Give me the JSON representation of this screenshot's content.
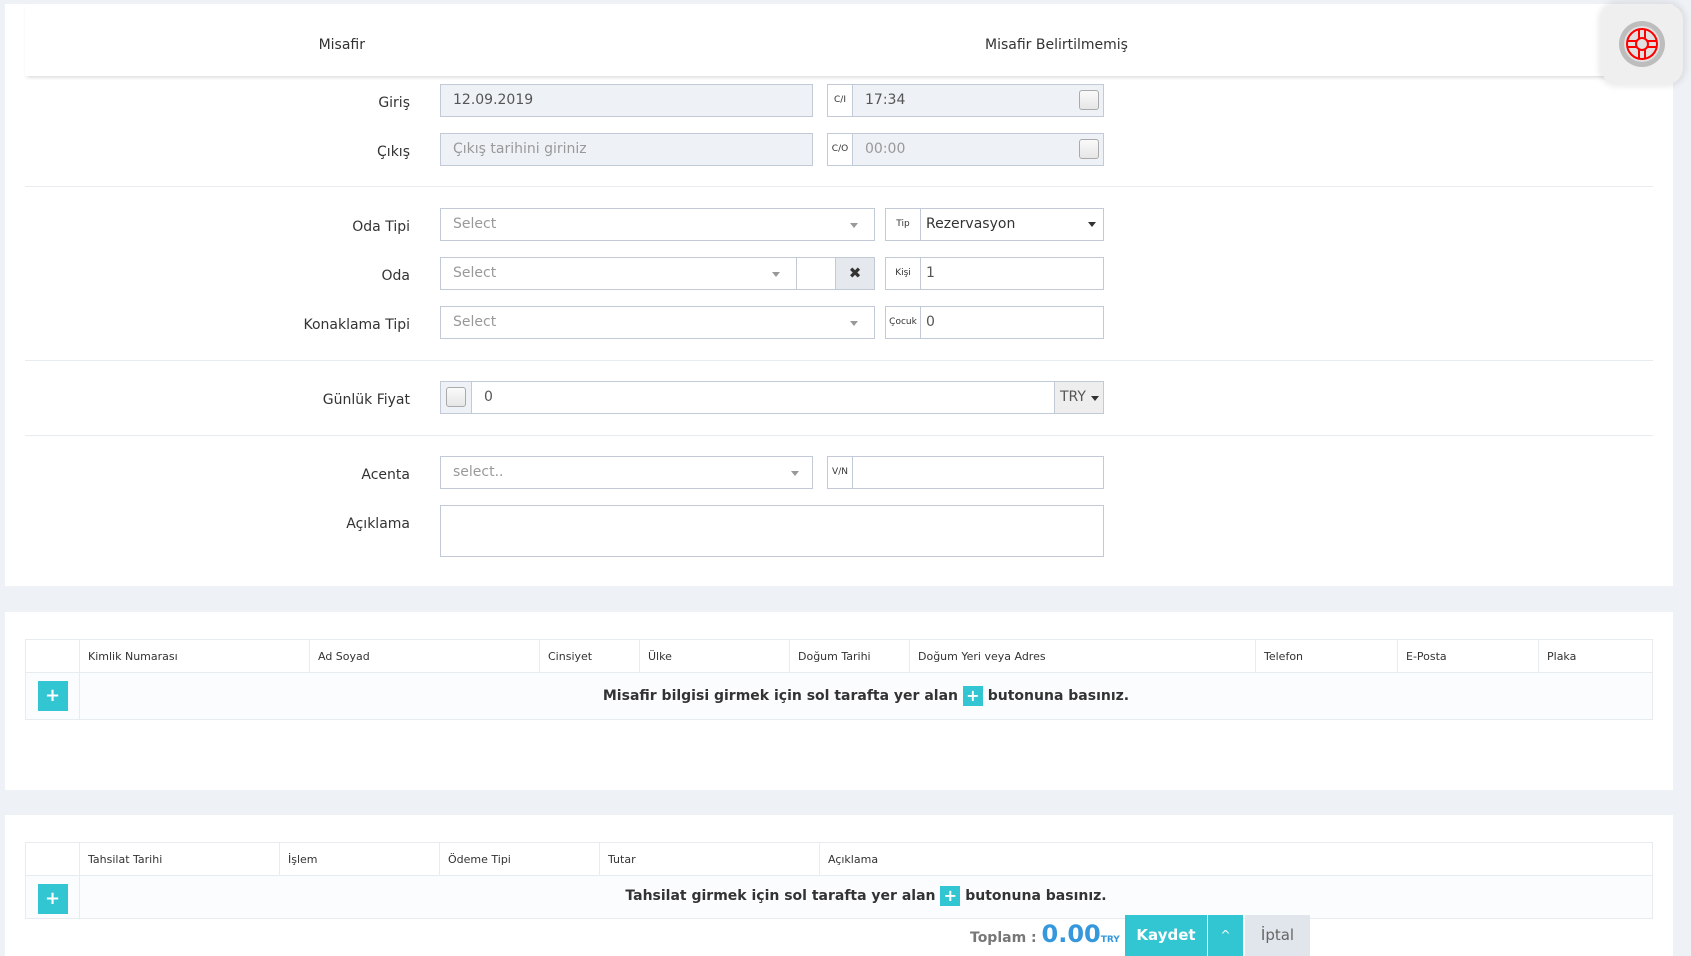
{
  "header": {
    "guest_label": "Misafir",
    "guest_value": "Misafir Belirtilmemiş"
  },
  "help_icon": "lifebuoy-icon",
  "form": {
    "checkin": {
      "label": "Giriş",
      "date": "12.09.2019",
      "time_addon": "C/I",
      "time": "17:34"
    },
    "checkout": {
      "label": "Çıkış",
      "date_placeholder": "Çıkış tarihini giriniz",
      "time_addon": "C/O",
      "time_placeholder": "00:00"
    },
    "room_type": {
      "label": "Oda Tipi",
      "placeholder": "Select"
    },
    "type": {
      "addon": "Tip",
      "value": "Rezervasyon"
    },
    "room": {
      "label": "Oda",
      "placeholder": "Select",
      "clear_icon": "close-icon"
    },
    "persons": {
      "addon": "Kişi",
      "value": "1"
    },
    "board_type": {
      "label": "Konaklama Tipi",
      "placeholder": "Select"
    },
    "children": {
      "addon": "Çocuk",
      "value": "0"
    },
    "daily_price": {
      "label": "Günlük Fiyat",
      "value": "0",
      "currency": "TRY"
    },
    "agency": {
      "label": "Acenta",
      "placeholder": "select..",
      "vn_addon": "V/N",
      "vn_value": ""
    },
    "note": {
      "label": "Açıklama",
      "value": ""
    }
  },
  "guests_table": {
    "columns": [
      "",
      "Kimlik Numarası",
      "Ad Soyad",
      "Cinsiyet",
      "Ülke",
      "Doğum Tarihi",
      "Doğum Yeri veya Adres",
      "Telefon",
      "E-Posta",
      "Plaka"
    ],
    "add_label": "+",
    "empty_msg_before": "Misafir bilgisi girmek için sol tarafta yer alan",
    "empty_msg_after": "butonuna basınız."
  },
  "payments_table": {
    "columns": [
      "",
      "Tahsilat Tarihi",
      "İşlem",
      "Ödeme Tipi",
      "Tutar",
      "Açıklama"
    ],
    "add_label": "+",
    "empty_msg_before": "Tahsilat girmek için sol tarafta yer alan",
    "empty_msg_after": "butonuna basınız."
  },
  "footer": {
    "total_label": "Toplam :",
    "total_value": "0.00",
    "total_currency": "TRY",
    "save": "Kaydet",
    "save_more": "^",
    "cancel": "İptal"
  },
  "colors": {
    "accent": "#32c5d2",
    "total": "#3598dc",
    "help_icon": "#ff0000"
  }
}
